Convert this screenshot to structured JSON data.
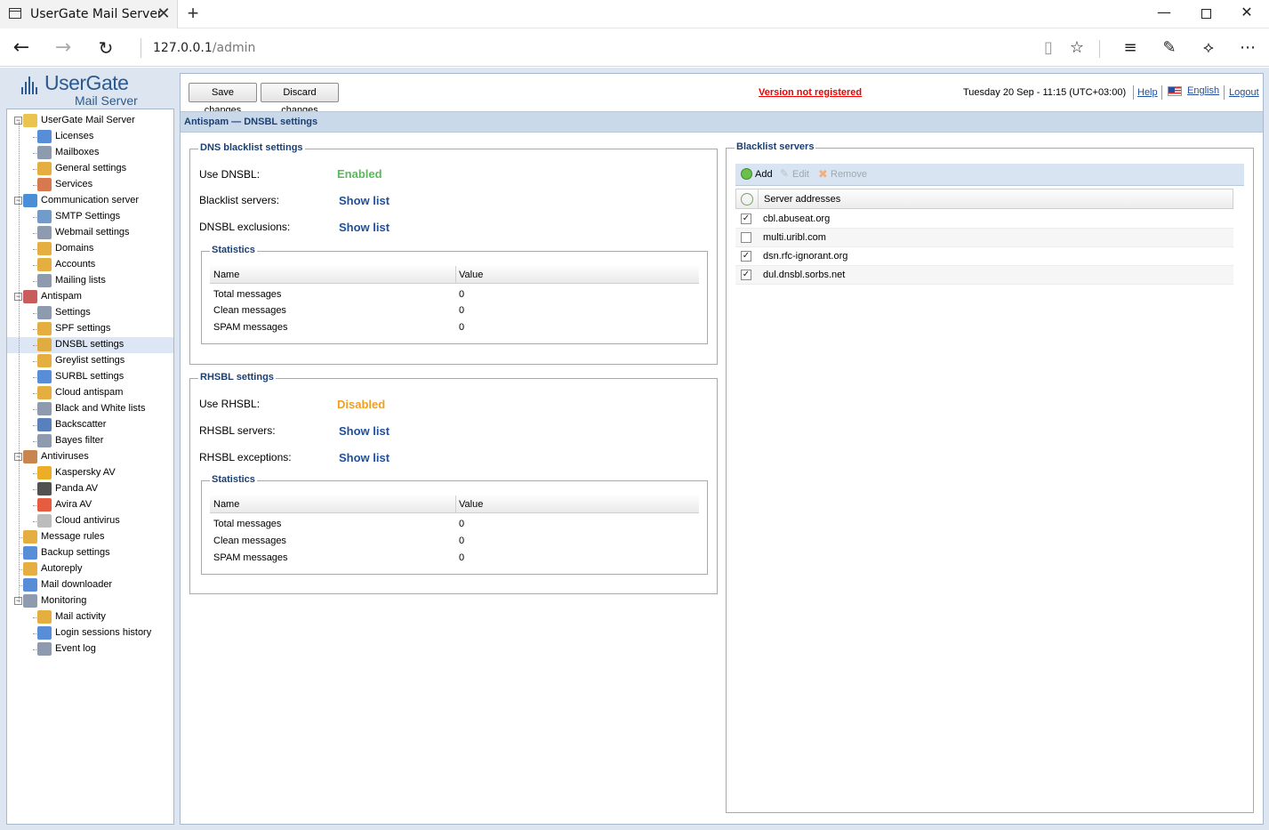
{
  "browser": {
    "tab_title": "UserGate Mail Server",
    "url_host": "127.0.0.1",
    "url_path": "/admin"
  },
  "logo": {
    "name": "UserGate",
    "subtitle": "Mail Server"
  },
  "sidebar": {
    "items": [
      {
        "label": "UserGate Mail Server",
        "level": 0,
        "expanded": true,
        "icon": "server-icon",
        "color": "#e8b830"
      },
      {
        "label": "Licenses",
        "level": 1,
        "icon": "info-icon",
        "color": "#3a7ad0"
      },
      {
        "label": "Mailboxes",
        "level": 1,
        "icon": "mailbox-icon",
        "color": "#7a8aa0"
      },
      {
        "label": "General settings",
        "level": 1,
        "icon": "settings-icon",
        "color": "#e0a020"
      },
      {
        "label": "Services",
        "level": 1,
        "icon": "services-icon",
        "color": "#d06030"
      },
      {
        "label": "Communication server",
        "level": 0,
        "expanded": true,
        "icon": "at-icon",
        "color": "#2a7ad0"
      },
      {
        "label": "SMTP Settings",
        "level": 1,
        "icon": "smtp-icon",
        "color": "#5a8ac0"
      },
      {
        "label": "Webmail settings",
        "level": 1,
        "icon": "webmail-icon",
        "color": "#7a8aa0"
      },
      {
        "label": "Domains",
        "level": 1,
        "icon": "domains-icon",
        "color": "#e0a020"
      },
      {
        "label": "Accounts",
        "level": 1,
        "icon": "accounts-icon",
        "color": "#e0a020"
      },
      {
        "label": "Mailing lists",
        "level": 1,
        "icon": "mailing-lists-icon",
        "color": "#7a8aa0"
      },
      {
        "label": "Antispam",
        "level": 0,
        "expanded": true,
        "icon": "antispam-icon",
        "color": "#c04040"
      },
      {
        "label": "Settings",
        "level": 1,
        "icon": "antispam-settings-icon",
        "color": "#7a8aa0"
      },
      {
        "label": "SPF settings",
        "level": 1,
        "icon": "spf-icon",
        "color": "#e0a020"
      },
      {
        "label": "DNSBL settings",
        "level": 1,
        "icon": "dnsbl-icon",
        "color": "#e0a020",
        "selected": true
      },
      {
        "label": "Greylist settings",
        "level": 1,
        "icon": "greylist-icon",
        "color": "#e0a020"
      },
      {
        "label": "SURBL settings",
        "level": 1,
        "icon": "surbl-icon",
        "color": "#3a7ad0"
      },
      {
        "label": "Cloud antispam",
        "level": 1,
        "icon": "cloud-antispam-icon",
        "color": "#e0a020"
      },
      {
        "label": "Black and White lists",
        "level": 1,
        "icon": "black-white-lists-icon",
        "color": "#7a8aa0"
      },
      {
        "label": "Backscatter",
        "level": 1,
        "icon": "backscatter-icon",
        "color": "#3a6ab0"
      },
      {
        "label": "Bayes filter",
        "level": 1,
        "icon": "bayes-filter-icon",
        "color": "#7a8aa0"
      },
      {
        "label": "Antiviruses",
        "level": 0,
        "expanded": true,
        "icon": "antivirus-icon",
        "color": "#c07030"
      },
      {
        "label": "Kaspersky AV",
        "level": 1,
        "icon": "kaspersky-icon",
        "color": "#e8a000"
      },
      {
        "label": "Panda AV",
        "level": 1,
        "icon": "panda-icon",
        "color": "#333333"
      },
      {
        "label": "Avira AV",
        "level": 1,
        "icon": "avira-icon",
        "color": "#e04020"
      },
      {
        "label": "Cloud antivirus",
        "level": 1,
        "icon": "cloud-antivirus-icon",
        "color": "#b0b0b0"
      },
      {
        "label": "Message rules",
        "level": 0,
        "icon": "message-rules-icon",
        "color": "#e0a020"
      },
      {
        "label": "Backup settings",
        "level": 0,
        "icon": "backup-icon",
        "color": "#3a7ad0"
      },
      {
        "label": "Autoreply",
        "level": 0,
        "icon": "autoreply-icon",
        "color": "#e0a020"
      },
      {
        "label": "Mail downloader",
        "level": 0,
        "icon": "mail-downloader-icon",
        "color": "#3a7ad0"
      },
      {
        "label": "Monitoring",
        "level": 0,
        "expanded": true,
        "icon": "monitoring-icon",
        "color": "#7a8aa0"
      },
      {
        "label": "Mail activity",
        "level": 1,
        "icon": "mail-activity-icon",
        "color": "#e0a020"
      },
      {
        "label": "Login sessions history",
        "level": 1,
        "icon": "login-history-icon",
        "color": "#3a7ad0"
      },
      {
        "label": "Event log",
        "level": 1,
        "icon": "event-log-icon",
        "color": "#7a8aa0"
      }
    ]
  },
  "toolbar": {
    "save_label": "Save changes",
    "discard_label": "Discard changes",
    "version_text": "Version not registered",
    "datetime": "Tuesday 20 Sep - 11:15 (UTC+03:00)",
    "help_label": "Help",
    "language_label": "English",
    "logout_label": "Logout"
  },
  "page": {
    "title": "Antispam — DNSBL settings"
  },
  "dns": {
    "legend": "DNS blacklist settings",
    "use_label": "Use DNSBL:",
    "use_value": "Enabled",
    "servers_label": "Blacklist servers:",
    "servers_link": "Show list",
    "exclusions_label": "DNSBL exclusions:",
    "exclusions_link": "Show list",
    "stats": {
      "legend": "Statistics",
      "col_name": "Name",
      "col_value": "Value",
      "rows": [
        {
          "name": "Total messages",
          "value": "0"
        },
        {
          "name": "Clean messages",
          "value": "0"
        },
        {
          "name": "SPAM messages",
          "value": "0"
        }
      ]
    }
  },
  "rhsbl": {
    "legend": "RHSBL settings",
    "use_label": "Use RHSBL:",
    "use_value": "Disabled",
    "servers_label": "RHSBL servers:",
    "servers_link": "Show list",
    "exceptions_label": "RHSBL exceptions:",
    "exceptions_link": "Show list",
    "stats": {
      "legend": "Statistics",
      "col_name": "Name",
      "col_value": "Value",
      "rows": [
        {
          "name": "Total messages",
          "value": "0"
        },
        {
          "name": "Clean messages",
          "value": "0"
        },
        {
          "name": "SPAM messages",
          "value": "0"
        }
      ]
    }
  },
  "blacklist": {
    "legend": "Blacklist servers",
    "add_label": "Add",
    "edit_label": "Edit",
    "remove_label": "Remove",
    "col_header": "Server addresses",
    "rows": [
      {
        "address": "cbl.abuseat.org",
        "checked": true
      },
      {
        "address": "multi.uribl.com",
        "checked": false
      },
      {
        "address": "dsn.rfc-ignorant.org",
        "checked": true
      },
      {
        "address": "dul.dnsbl.sorbs.net",
        "checked": true
      }
    ]
  },
  "colors": {
    "enabled": "#5bb85b",
    "disabled": "#f0a020",
    "link": "#1f4f9e",
    "header": "#1c3f73",
    "warning": "#e00000"
  }
}
